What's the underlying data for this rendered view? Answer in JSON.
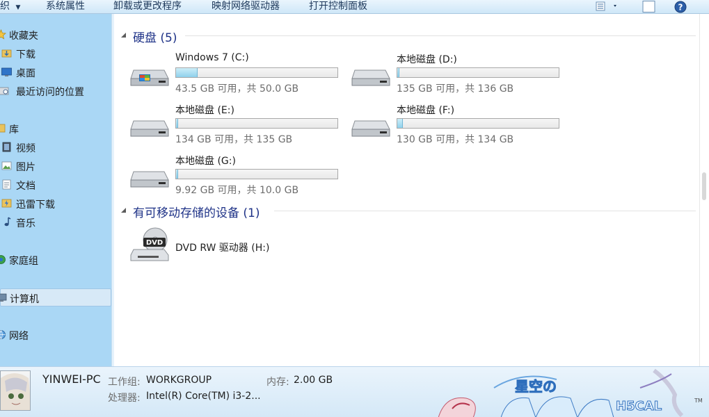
{
  "toolbar": {
    "organize": "织",
    "items": [
      "系统属性",
      "卸载或更改程序",
      "映射网络驱动器",
      "打开控制面板"
    ]
  },
  "sidebar": {
    "favorites": [
      {
        "label": "收藏夹",
        "icon": "star-icon"
      },
      {
        "label": "下载",
        "icon": "download-folder-icon"
      },
      {
        "label": "桌面",
        "icon": "desktop-icon"
      },
      {
        "label": "最近访问的位置",
        "icon": "recent-places-icon"
      }
    ],
    "libraries": [
      {
        "label": "库",
        "icon": "library-icon"
      },
      {
        "label": "视频",
        "icon": "video-icon"
      },
      {
        "label": "图片",
        "icon": "picture-icon"
      },
      {
        "label": "文档",
        "icon": "document-icon"
      },
      {
        "label": "迅雷下载",
        "icon": "thunder-download-icon"
      },
      {
        "label": "音乐",
        "icon": "music-icon"
      }
    ],
    "homegroup": "家庭组",
    "computer": "计算机",
    "network": "网络"
  },
  "hard_disks": {
    "title": "硬盘 (5)",
    "drives": [
      {
        "name": "Windows 7 (C:)",
        "size": "43.5 GB 可用，共 50.0 GB",
        "used_fraction": 0.13
      },
      {
        "name": "本地磁盘 (D:)",
        "size": "135 GB 可用，共 136 GB",
        "used_fraction": 0.007
      },
      {
        "name": "本地磁盘 (E:)",
        "size": "134 GB 可用，共 135 GB",
        "used_fraction": 0.007
      },
      {
        "name": "本地磁盘 (F:)",
        "size": "130 GB 可用，共 134 GB",
        "used_fraction": 0.03
      },
      {
        "name": "本地磁盘 (G:)",
        "size": "9.92 GB 可用，共 10.0 GB",
        "used_fraction": 0.008
      }
    ]
  },
  "removable": {
    "title": "有可移动存储的设备 (1)",
    "drives": [
      {
        "name": "DVD RW 驱动器 (H:)",
        "icon": "dvd-drive-icon",
        "badge": "DVD"
      }
    ]
  },
  "details": {
    "pc_name": "YINWEI-PC",
    "workgroup_label": "工作组:",
    "workgroup_value": "WORKGROUP",
    "memory_label": "内存:",
    "memory_value": "2.00 GB",
    "processor_label": "处理器:",
    "processor_value": "Intel(R) Core(TM) i3-2...",
    "trademark": "TM"
  },
  "colors": {
    "sidebar_bg": "#aad7f5",
    "group_title": "#1e3287",
    "bar_fill": "#8fd0ec"
  }
}
